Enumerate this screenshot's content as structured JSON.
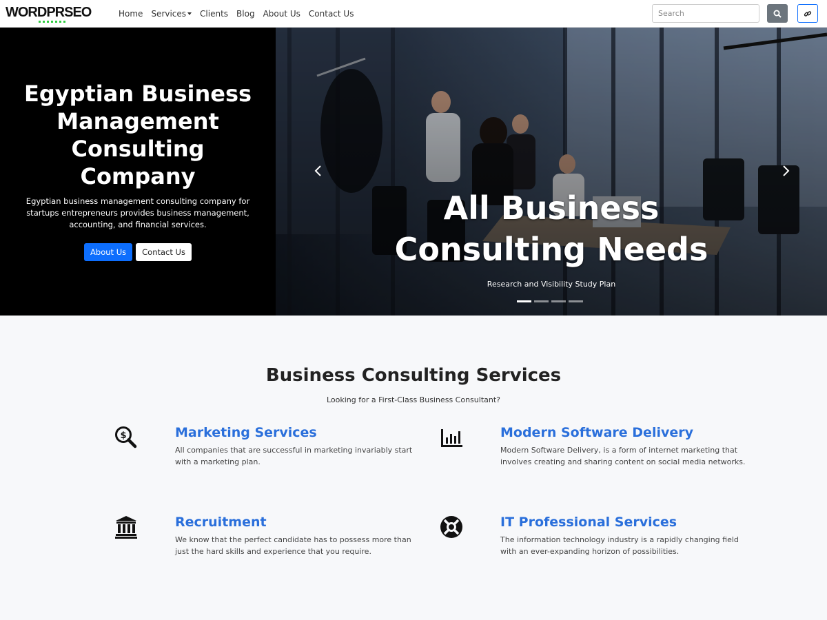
{
  "nav": {
    "logo": "WORDPRSEO",
    "links": [
      "Home",
      "Services",
      "Clients",
      "Blog",
      "About Us",
      "Contact Us"
    ],
    "search_placeholder": "Search"
  },
  "hero": {
    "title": "Egyptian Business Management Consulting Company",
    "description": "Egyptian business management consulting company for startups entrepreneurs provides business management, accounting, and financial services.",
    "btn_about": "About Us",
    "btn_contact": "Contact Us"
  },
  "carousel": {
    "caption_title": "All Business Consulting Needs",
    "caption_subtitle": "Research and Visibility Study Plan",
    "slide_count": 4,
    "active_slide": 1
  },
  "services": {
    "title": "Business Consulting Services",
    "subtitle": "Looking for a First-Class Business Consultant?",
    "items": [
      {
        "title": "Marketing Services",
        "text": "All companies that are successful in marketing invariably start with a marketing plan.",
        "icon": "search-dollar-icon"
      },
      {
        "title": "Modern Software Delivery",
        "text": "Modern Software Delivery, is a form of internet marketing that involves creating and sharing content on social media networks.",
        "icon": "bar-chart-icon"
      },
      {
        "title": "Recruitment",
        "text": "We know that the perfect candidate has to possess more than just the hard skills and experience that you require.",
        "icon": "bank-icon"
      },
      {
        "title": "IT Professional Services",
        "text": "The information technology industry is a rapidly changing field with an ever-expanding horizon of possibilities.",
        "icon": "life-ring-icon"
      }
    ]
  },
  "colors": {
    "primary": "#0d6efd",
    "service_title": "#2a6fdb",
    "logo_dots": "#2ecc40"
  }
}
